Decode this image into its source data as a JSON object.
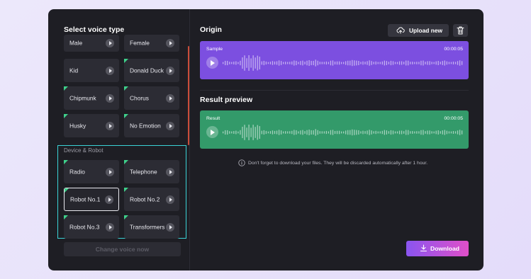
{
  "left_panel": {
    "title": "Select voice type",
    "voices": [
      {
        "label": "Male",
        "badge": false
      },
      {
        "label": "Female",
        "badge": false
      },
      {
        "label": "Kid",
        "badge": false
      },
      {
        "label": "Donald Duck",
        "badge": true
      },
      {
        "label": "Chipmunk",
        "badge": true
      },
      {
        "label": "Chorus",
        "badge": true
      },
      {
        "label": "Husky",
        "badge": true
      },
      {
        "label": "No Emotion",
        "badge": true
      }
    ],
    "device_group": {
      "title": "Device & Robot",
      "voices": [
        {
          "label": "Radio",
          "badge": true,
          "selected": false
        },
        {
          "label": "Telephone",
          "badge": true,
          "selected": false
        },
        {
          "label": "Robot No.1",
          "badge": true,
          "selected": true
        },
        {
          "label": "Robot No.2",
          "badge": true,
          "selected": false
        },
        {
          "label": "Robot No.3",
          "badge": true,
          "selected": false
        },
        {
          "label": "Transformers",
          "badge": true,
          "selected": false
        }
      ]
    },
    "change_button": "Change voice now"
  },
  "origin": {
    "title": "Origin",
    "upload_label": "Upload new",
    "track_name": "Sample",
    "duration": "00:00:05",
    "color": "#7c4fe0"
  },
  "result": {
    "title": "Result preview",
    "track_name": "Result",
    "duration": "00:00:05",
    "color": "#339a6a"
  },
  "notice": "Don't forget to download your files. They will be discarded automatically after 1 hour.",
  "download_label": "Download",
  "colors": {
    "accent_group_border": "#3ad3d6",
    "badge": "#3ed08a",
    "download_gradient": [
      "#8a55f0",
      "#e04fc8"
    ]
  }
}
